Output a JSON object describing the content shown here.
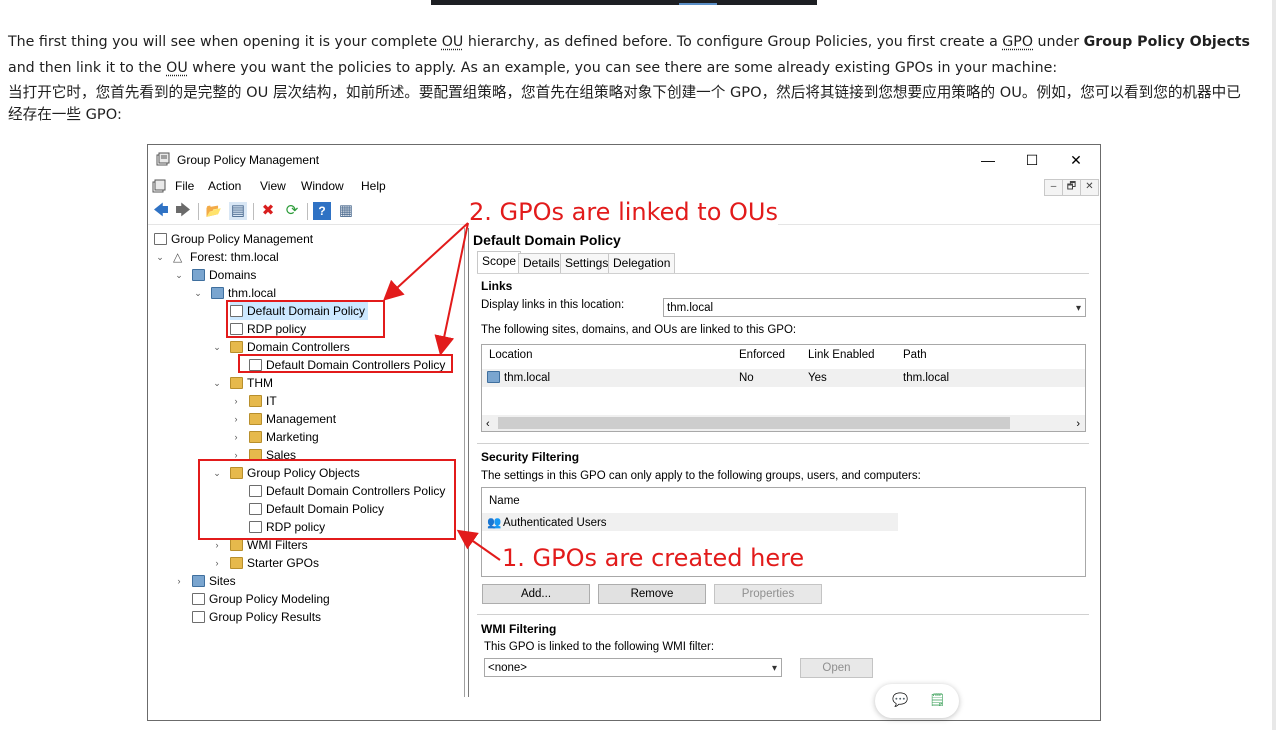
{
  "article": {
    "en_before_ou": "The first thing you will see when opening it is your complete ",
    "ou": "OU",
    "en_after_ou": " hierarchy, as defined before. To configure Group Policies, you first create a ",
    "gpo": "GPO",
    "en_under": " under ",
    "gpo_objects_bold": "Group Policy Objects",
    "en_link": " and then link it to the ",
    "ou2": "OU",
    "en_end": " where you want the policies to apply. As an example, you can see there are some already existing GPOs in your machine:",
    "zh": "当打开它时，您首先看到的是完整的 OU 层次结构，如前所述。要配置组策略，您首先在组策略对象下创建一个 GPO，然后将其链接到您想要应用策略的 OU。例如，您可以看到您的机器中已经存在一些 GPO:"
  },
  "window": {
    "title": "Group Policy Management",
    "controls": {
      "minimize": "—",
      "maximize": "☐",
      "close": "✕"
    },
    "menu": [
      "File",
      "Action",
      "View",
      "Window",
      "Help"
    ],
    "mdi": [
      "–",
      "🗗",
      "✕"
    ]
  },
  "toolbar": {
    "back": "🡄",
    "forward": "🡆",
    "up": "📂",
    "show_hide": "▤",
    "delete": "✖",
    "refresh": "⟳",
    "help": "?",
    "view": "▦"
  },
  "tree": {
    "root": "Group Policy Management",
    "forest": "Forest: thm.local",
    "domains": "Domains",
    "domain": "thm.local",
    "ddp": "Default Domain Policy",
    "rdp": "RDP policy",
    "dc": "Domain Controllers",
    "ddcp": "Default Domain Controllers Policy",
    "thm": "THM",
    "it": "IT",
    "management": "Management",
    "marketing": "Marketing",
    "sales": "Sales",
    "gpo_folder": "Group Policy Objects",
    "gpo1": "Default Domain Controllers Policy",
    "gpo2": "Default Domain Policy",
    "gpo3": "RDP policy",
    "wmi": "WMI Filters",
    "starter": "Starter GPOs",
    "sites": "Sites",
    "modeling": "Group Policy Modeling",
    "results": "Group Policy Results"
  },
  "details": {
    "title": "Default Domain Policy",
    "tabs": [
      "Scope",
      "Details",
      "Settings",
      "Delegation"
    ],
    "links": {
      "heading": "Links",
      "display_label": "Display links in this location:",
      "location_value": "thm.local",
      "desc": "The following sites, domains, and OUs are linked to this GPO:",
      "columns": [
        "Location",
        "Enforced",
        "Link Enabled",
        "Path"
      ],
      "row": [
        "thm.local",
        "No",
        "Yes",
        "thm.local"
      ]
    },
    "security": {
      "heading": "Security Filtering",
      "desc": "The settings in this GPO can only apply to the following groups, users, and computers:",
      "column": "Name",
      "row": "Authenticated Users",
      "buttons": [
        "Add...",
        "Remove",
        "Properties"
      ]
    },
    "wmi": {
      "heading": "WMI Filtering",
      "desc": "This GPO is linked to the following WMI filter:",
      "value": "<none>",
      "open": "Open"
    }
  },
  "annotations": {
    "linked": "2. GPOs are linked to OUs",
    "created": "1. GPOs are created here"
  },
  "colors": {
    "annotation": "#e21b1b",
    "selection": "#cce8ff",
    "link": "#3da15b"
  }
}
